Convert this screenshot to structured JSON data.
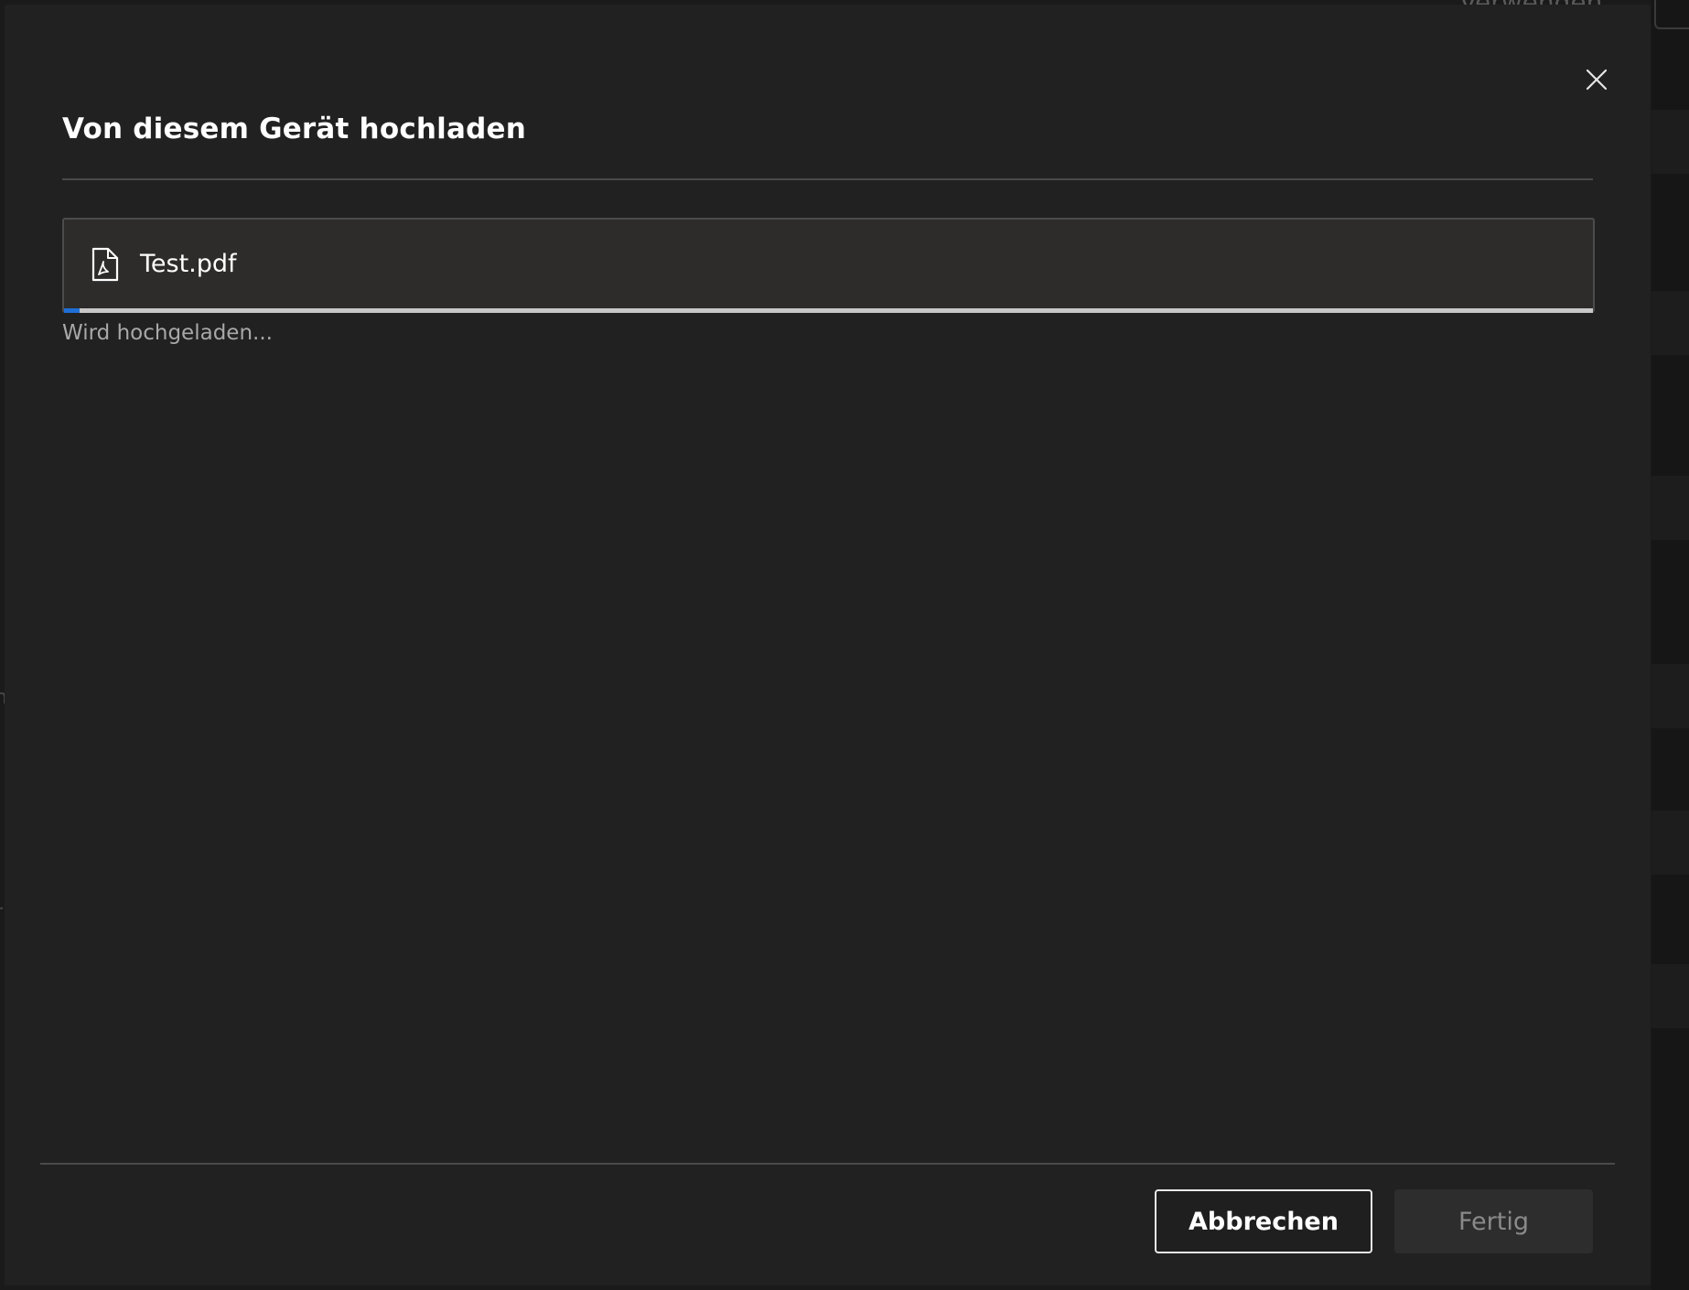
{
  "background": {
    "top_button_label": "Verwenden"
  },
  "dialog": {
    "title": "Von diesem Gerät hochladen",
    "close_icon": "close-icon",
    "file": {
      "icon": "pdf-file-icon",
      "name": "Test.pdf",
      "upload_progress_percent": 1
    },
    "status": "Wird hochgeladen...",
    "buttons": {
      "cancel_label": "Abbrechen",
      "done_label": "Fertig",
      "done_enabled": false
    }
  },
  "colors": {
    "dialog_bg": "#212121",
    "accent_progress": "#1f6fd6",
    "text_primary": "#ffffff",
    "text_secondary": "#a8a8a8"
  }
}
